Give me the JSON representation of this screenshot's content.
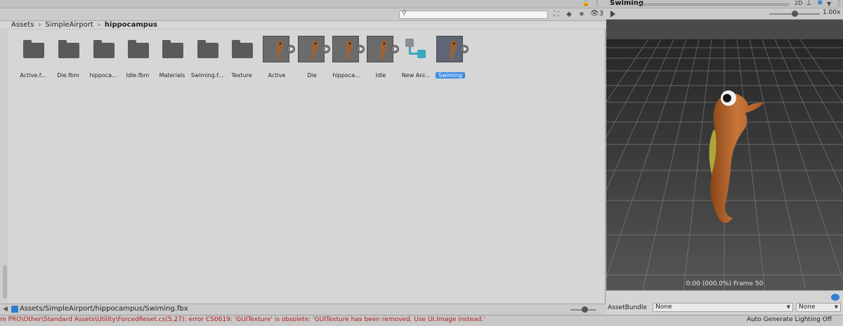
{
  "project": {
    "search": {
      "placeholder": "",
      "value": ""
    },
    "hidden_packages": "3",
    "breadcrumb": [
      "Assets",
      "SimpleAirport",
      "hippocampus"
    ],
    "assets": [
      {
        "label": "Active.f...",
        "type": "folder"
      },
      {
        "label": "Die.fbm",
        "type": "folder"
      },
      {
        "label": "hippoca...",
        "type": "folder"
      },
      {
        "label": "Idle.fbm",
        "type": "folder"
      },
      {
        "label": "Materials",
        "type": "folder"
      },
      {
        "label": "Swiming.f...",
        "type": "folder"
      },
      {
        "label": "Texture",
        "type": "folder"
      },
      {
        "label": "Active",
        "type": "animation-clip"
      },
      {
        "label": "Die",
        "type": "animation-clip"
      },
      {
        "label": "hippoca...",
        "type": "animation-clip"
      },
      {
        "label": "Idle",
        "type": "animation-clip"
      },
      {
        "label": "New Ani...",
        "type": "animator-controller"
      },
      {
        "label": "Swiming",
        "type": "animation-clip",
        "selected": true
      }
    ],
    "selected_path": "Assets/SimpleAirport/hippocampus/Swiming.fbx"
  },
  "preview": {
    "title": "Swiming",
    "mode_2d": "2D",
    "speed": "1.00x",
    "frame_info": "0:00 (000.0%) Frame 50",
    "asset_bundle": {
      "label": "AssetBundle",
      "bundle": "None",
      "variant": "None"
    }
  },
  "console": {
    "error": "m PRO\\Other\\Standard Assets\\Utility\\ForcedReset.cs(5,27): error CS0619: 'GUITexture' is obsolete: 'GUITexture has been removed. Use UI.Image instead.'",
    "lighting": "Auto Generate Lighting Off"
  },
  "colors": {
    "accent": "#3c8ce7",
    "error": "#b31b1b",
    "viewport": "#3c3c3c"
  }
}
